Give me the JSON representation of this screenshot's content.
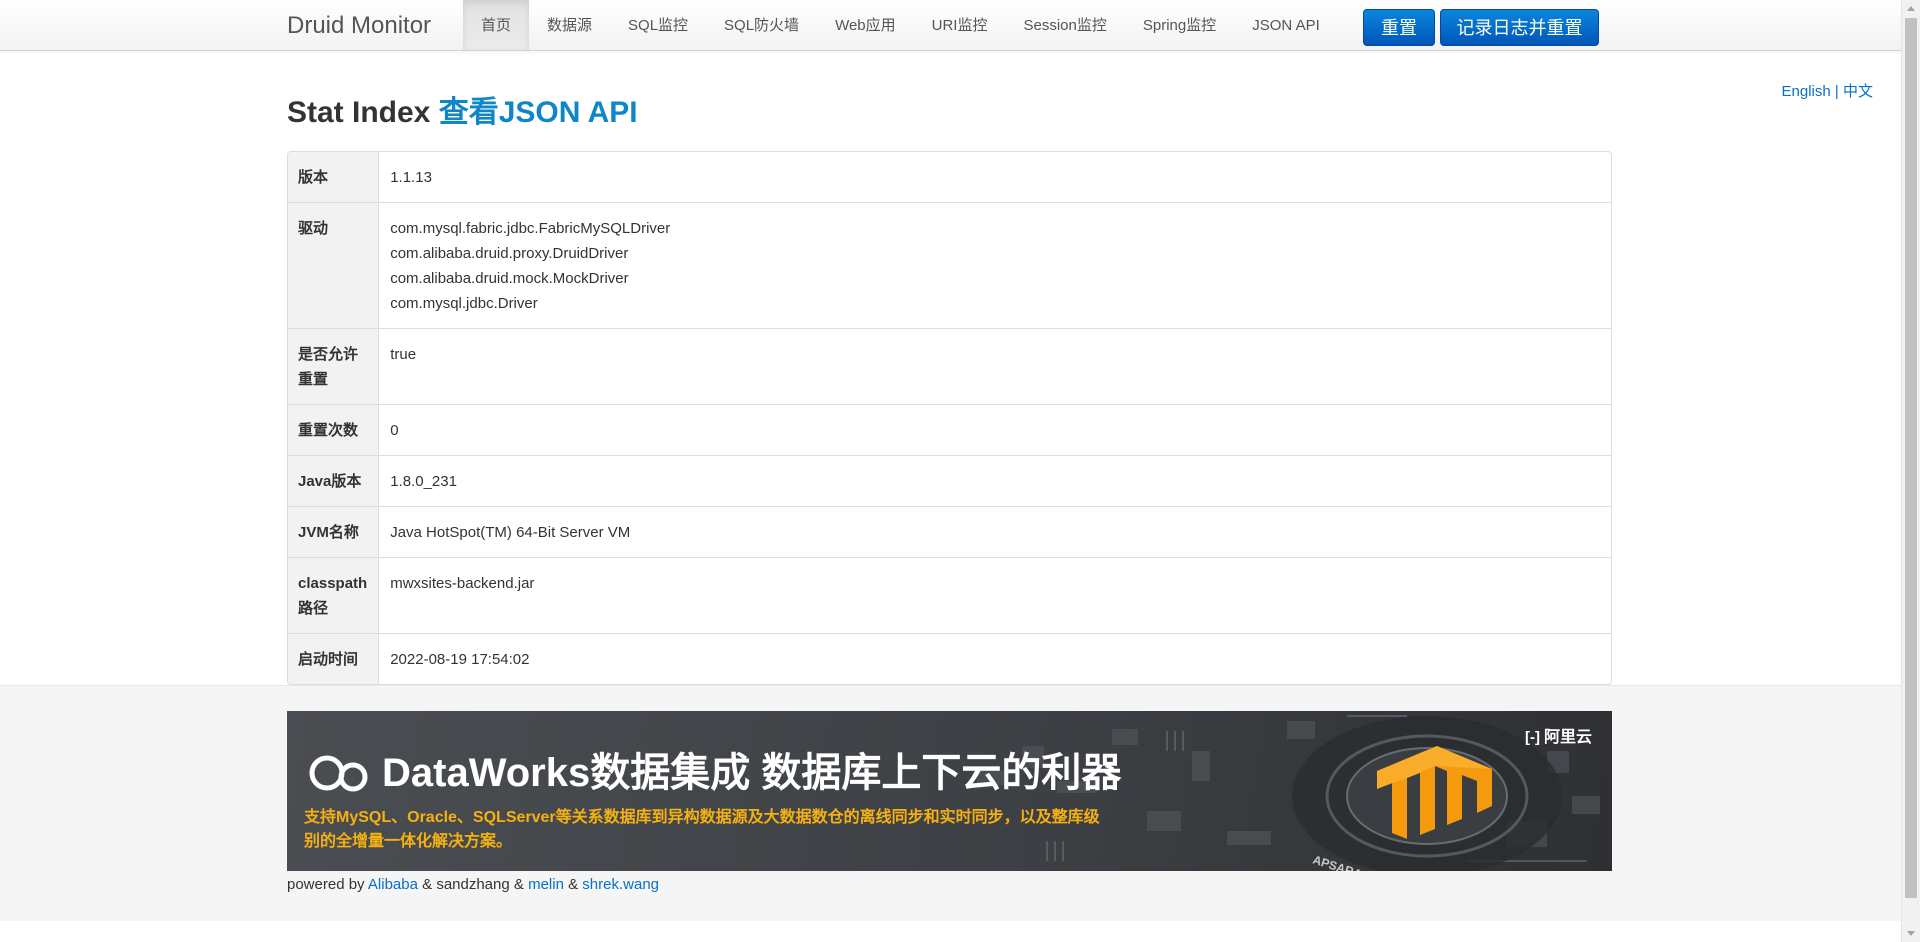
{
  "navbar": {
    "brand": "Druid Monitor",
    "items": [
      {
        "label": "首页",
        "active": true
      },
      {
        "label": "数据源"
      },
      {
        "label": "SQL监控"
      },
      {
        "label": "SQL防火墙"
      },
      {
        "label": "Web应用"
      },
      {
        "label": "URI监控"
      },
      {
        "label": "Session监控"
      },
      {
        "label": "Spring监控"
      },
      {
        "label": "JSON API"
      }
    ],
    "reset_button": "重置",
    "log_reset_button": "记录日志并重置"
  },
  "lang": {
    "english": "English",
    "separator": "|",
    "chinese": "中文"
  },
  "page": {
    "title": "Stat Index",
    "json_link": "查看JSON API"
  },
  "stats": {
    "version": {
      "label": "版本",
      "value": "1.1.13"
    },
    "drivers": {
      "label": "驱动",
      "values": [
        "com.mysql.fabric.jdbc.FabricMySQLDriver",
        "com.alibaba.druid.proxy.DruidDriver",
        "com.alibaba.druid.mock.MockDriver",
        "com.mysql.jdbc.Driver"
      ]
    },
    "reset_enable": {
      "label": "是否允许重置",
      "value": "true"
    },
    "reset_count": {
      "label": "重置次数",
      "value": "0"
    },
    "java_version": {
      "label": "Java版本",
      "value": "1.8.0_231"
    },
    "jvm_name": {
      "label": "JVM名称",
      "value": "Java HotSpot(TM) 64-Bit Server VM"
    },
    "classpath": {
      "label": "classpath路径",
      "value": "mwxsites-backend.jar"
    },
    "start_time": {
      "label": "启动时间",
      "value": "2022-08-19 17:54:02"
    }
  },
  "banner": {
    "title": "DataWorks数据集成 数据库上下云的利器",
    "subtitle": "支持MySQL、Oracle、SQLServer等关系数据库到异构数据源及大数据数仓的离线同步和实时同步，以及整库级别的全增量一体化解决方案。",
    "brand": "阿里云",
    "brand_bracket": "[-]",
    "art_text": "APSARA",
    "accent_color": "#f59a0c"
  },
  "footer": {
    "powered_by": "powered by",
    "alibaba": "Alibaba",
    "amp": "&",
    "sandzhang": "sandzhang",
    "melin": "melin",
    "shrek": "shrek.wang"
  }
}
